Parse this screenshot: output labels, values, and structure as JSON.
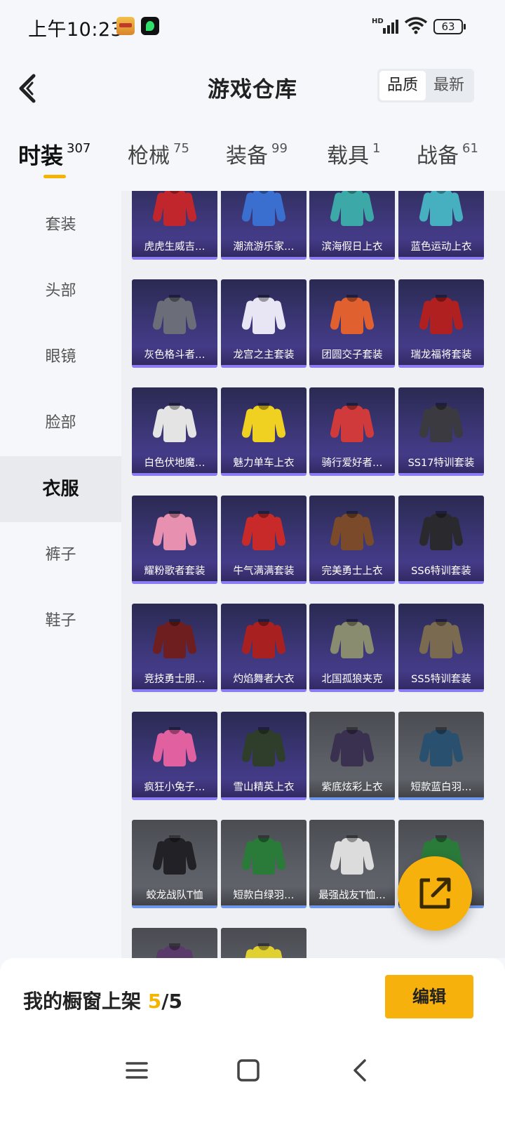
{
  "status_bar": {
    "time": "上午10:23",
    "network": "HD",
    "battery": "63"
  },
  "header": {
    "title": "游戏仓库",
    "sort_options": [
      "品质",
      "最新"
    ],
    "sort_active": "品质"
  },
  "tabs": [
    {
      "label": "时装",
      "count": "307"
    },
    {
      "label": "枪械",
      "count": "75"
    },
    {
      "label": "装备",
      "count": "99"
    },
    {
      "label": "载具",
      "count": "1"
    },
    {
      "label": "战备",
      "count": "61"
    }
  ],
  "active_tab": "时装",
  "sidebar": [
    "套装",
    "头部",
    "眼镜",
    "脸部",
    "衣服",
    "裤子",
    "鞋子"
  ],
  "active_sidebar": "衣服",
  "items": [
    {
      "name": "虎虎生威吉…",
      "tier": "purple",
      "color": "#c0262b"
    },
    {
      "name": "潮流游乐家…",
      "tier": "purple",
      "color": "#3a6fd0"
    },
    {
      "name": "滨海假日上衣",
      "tier": "purple",
      "color": "#3ca8a8"
    },
    {
      "name": "蓝色运动上衣",
      "tier": "purple",
      "color": "#46b0c0"
    },
    {
      "name": "灰色格斗者…",
      "tier": "purple",
      "color": "#6b6e78"
    },
    {
      "name": "龙宫之主套装",
      "tier": "purple",
      "color": "#e8e6f4"
    },
    {
      "name": "团圆交子套装",
      "tier": "purple",
      "color": "#e06030"
    },
    {
      "name": "瑞龙福将套装",
      "tier": "purple",
      "color": "#b02020"
    },
    {
      "name": "白色伏地魔…",
      "tier": "purple",
      "color": "#e4e4e4"
    },
    {
      "name": "魅力单车上衣",
      "tier": "purple",
      "color": "#f0d020"
    },
    {
      "name": "骑行爱好者…",
      "tier": "purple",
      "color": "#d03a3a"
    },
    {
      "name": "SS17特训套装",
      "tier": "purple",
      "color": "#3a3a40"
    },
    {
      "name": "耀粉歌者套装",
      "tier": "purple",
      "color": "#e890b0"
    },
    {
      "name": "牛气满满套装",
      "tier": "purple",
      "color": "#c82a2a"
    },
    {
      "name": "完美勇士上衣",
      "tier": "purple",
      "color": "#7a4a2a"
    },
    {
      "name": "SS6特训套装",
      "tier": "purple",
      "color": "#2a2a2e"
    },
    {
      "name": "竞技勇士朋…",
      "tier": "purple",
      "color": "#6e1e1e"
    },
    {
      "name": "灼焰舞者大衣",
      "tier": "purple",
      "color": "#a82020"
    },
    {
      "name": "北国孤狼夹克",
      "tier": "purple",
      "color": "#8a8c70"
    },
    {
      "name": "SS5特训套装",
      "tier": "purple",
      "color": "#7a6a50"
    },
    {
      "name": "疯狂小兔子…",
      "tier": "purple",
      "color": "#e060a0"
    },
    {
      "name": "雪山精英上衣",
      "tier": "purple",
      "color": "#2e3e2a"
    },
    {
      "name": "紫底炫彩上衣",
      "tier": "grey",
      "color": "#3a3050"
    },
    {
      "name": "短款蓝白羽…",
      "tier": "grey",
      "color": "#2a5070"
    },
    {
      "name": "蛟龙战队T恤",
      "tier": "grey",
      "color": "#222226"
    },
    {
      "name": "短款白绿羽…",
      "tier": "grey",
      "color": "#2a7a3a"
    },
    {
      "name": "最强战友T恤…",
      "tier": "grey",
      "color": "#dcdcdc"
    },
    {
      "name": "",
      "tier": "grey",
      "color": "#2a7a3a"
    },
    {
      "name": "",
      "tier": "grey",
      "color": "#5a3a6a"
    },
    {
      "name": "",
      "tier": "grey",
      "color": "#e0d030"
    }
  ],
  "footer": {
    "shelf_label": "我的橱窗上架",
    "shelf_current": "5",
    "shelf_total": "/5",
    "edit_label": "编辑"
  },
  "colors": {
    "accent": "#f7b10c",
    "card_purple": "#3d3779",
    "card_grey": "#5c5f66"
  }
}
